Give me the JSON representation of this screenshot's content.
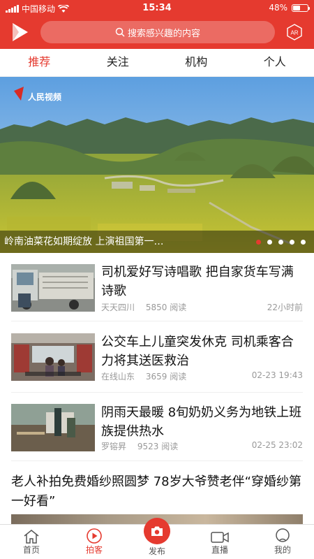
{
  "status_bar": {
    "carrier": "中国移动",
    "time": "15:34",
    "battery": "48%",
    "battery_level": 0.48
  },
  "header": {
    "search_placeholder": "搜索感兴趣的内容",
    "ar_label": "AR"
  },
  "tabs": [
    {
      "label": "推荐",
      "active": true
    },
    {
      "label": "关注",
      "active": false
    },
    {
      "label": "机构",
      "active": false
    },
    {
      "label": "个人",
      "active": false
    }
  ],
  "banner": {
    "watermark": "人民视频",
    "caption": "岭南油菜花如期绽放 上演祖国第一…",
    "slide_count": 5,
    "active_slide": 1
  },
  "news": [
    {
      "title": "司机爱好写诗唱歌 把自家货车写满诗歌",
      "source": "天天四川",
      "views": "5850 阅读",
      "time": "22小时前"
    },
    {
      "title": "公交车上儿童突发休克 司机乘客合力将其送医救治",
      "source": "在线山东",
      "views": "3659 阅读",
      "time": "02-23 19:43"
    },
    {
      "title": "阴雨天最暖 8旬奶奶义务为地铁上班族提供热水",
      "source": "罗镕昇",
      "views": "9523 阅读",
      "time": "02-25 23:02"
    }
  ],
  "featured": {
    "title": "老人补拍免费婚纱照圆梦 78岁大爷赞老伴“穿婚纱第一好看”"
  },
  "bottom_nav": [
    {
      "label": "首页",
      "icon": "home-icon",
      "active": false
    },
    {
      "label": "拍客",
      "icon": "play-circle-icon",
      "active": true
    },
    {
      "label": "发布",
      "icon": "camera-icon",
      "active": false
    },
    {
      "label": "直播",
      "icon": "live-video-icon",
      "active": false
    },
    {
      "label": "我的",
      "icon": "user-icon",
      "active": false
    }
  ],
  "colors": {
    "brand_red": "#e53a2f",
    "meta_gray": "#999999"
  }
}
